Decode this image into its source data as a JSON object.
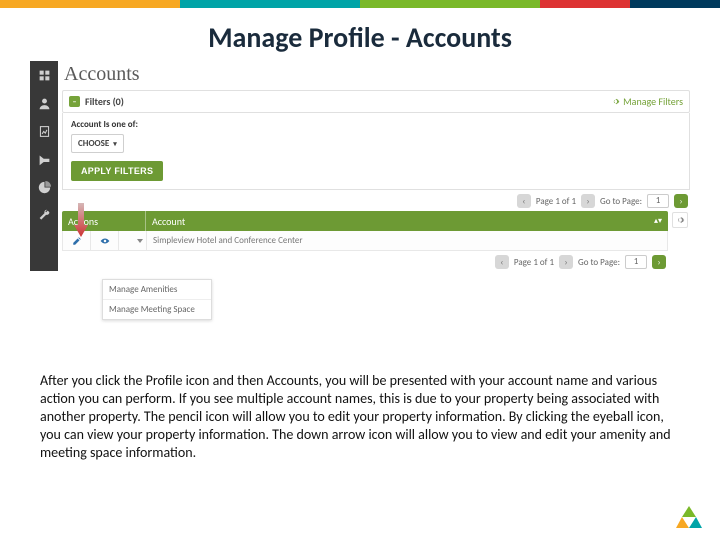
{
  "slide": {
    "title": "Manage Profile - Accounts"
  },
  "app": {
    "page_heading": "Accounts",
    "filters": {
      "label": "Filters (0)",
      "manage": "Manage Filters",
      "field_label": "Account Is one of:",
      "choose": "CHOOSE"
    },
    "apply_btn": "APPLY FILTERS",
    "pager_top": {
      "status": "Page 1 of 1",
      "goto_label": "Go to Page:",
      "goto_value": "1"
    },
    "grid": {
      "cols": {
        "actions": "Actions",
        "account": "Account"
      },
      "row": {
        "account_name": "Simpleview Hotel and Conference Center"
      },
      "dropdown": {
        "amenities": "Manage Amenities",
        "meeting": "Manage Meeting Space"
      }
    },
    "pager_bottom": {
      "status": "Page 1 of 1",
      "goto_label": "Go to Page:",
      "goto_value": "1"
    }
  },
  "body_text": "After you click the Profile icon and then Accounts, you will be presented with your account name and various action you can perform.  If you see multiple account names, this is due to your property being associated with another property.  The pencil icon will allow you to edit your property information.  By clicking the eyeball icon, you can view your property information.  The down arrow icon will allow you to view and edit your amenity and meeting space information."
}
